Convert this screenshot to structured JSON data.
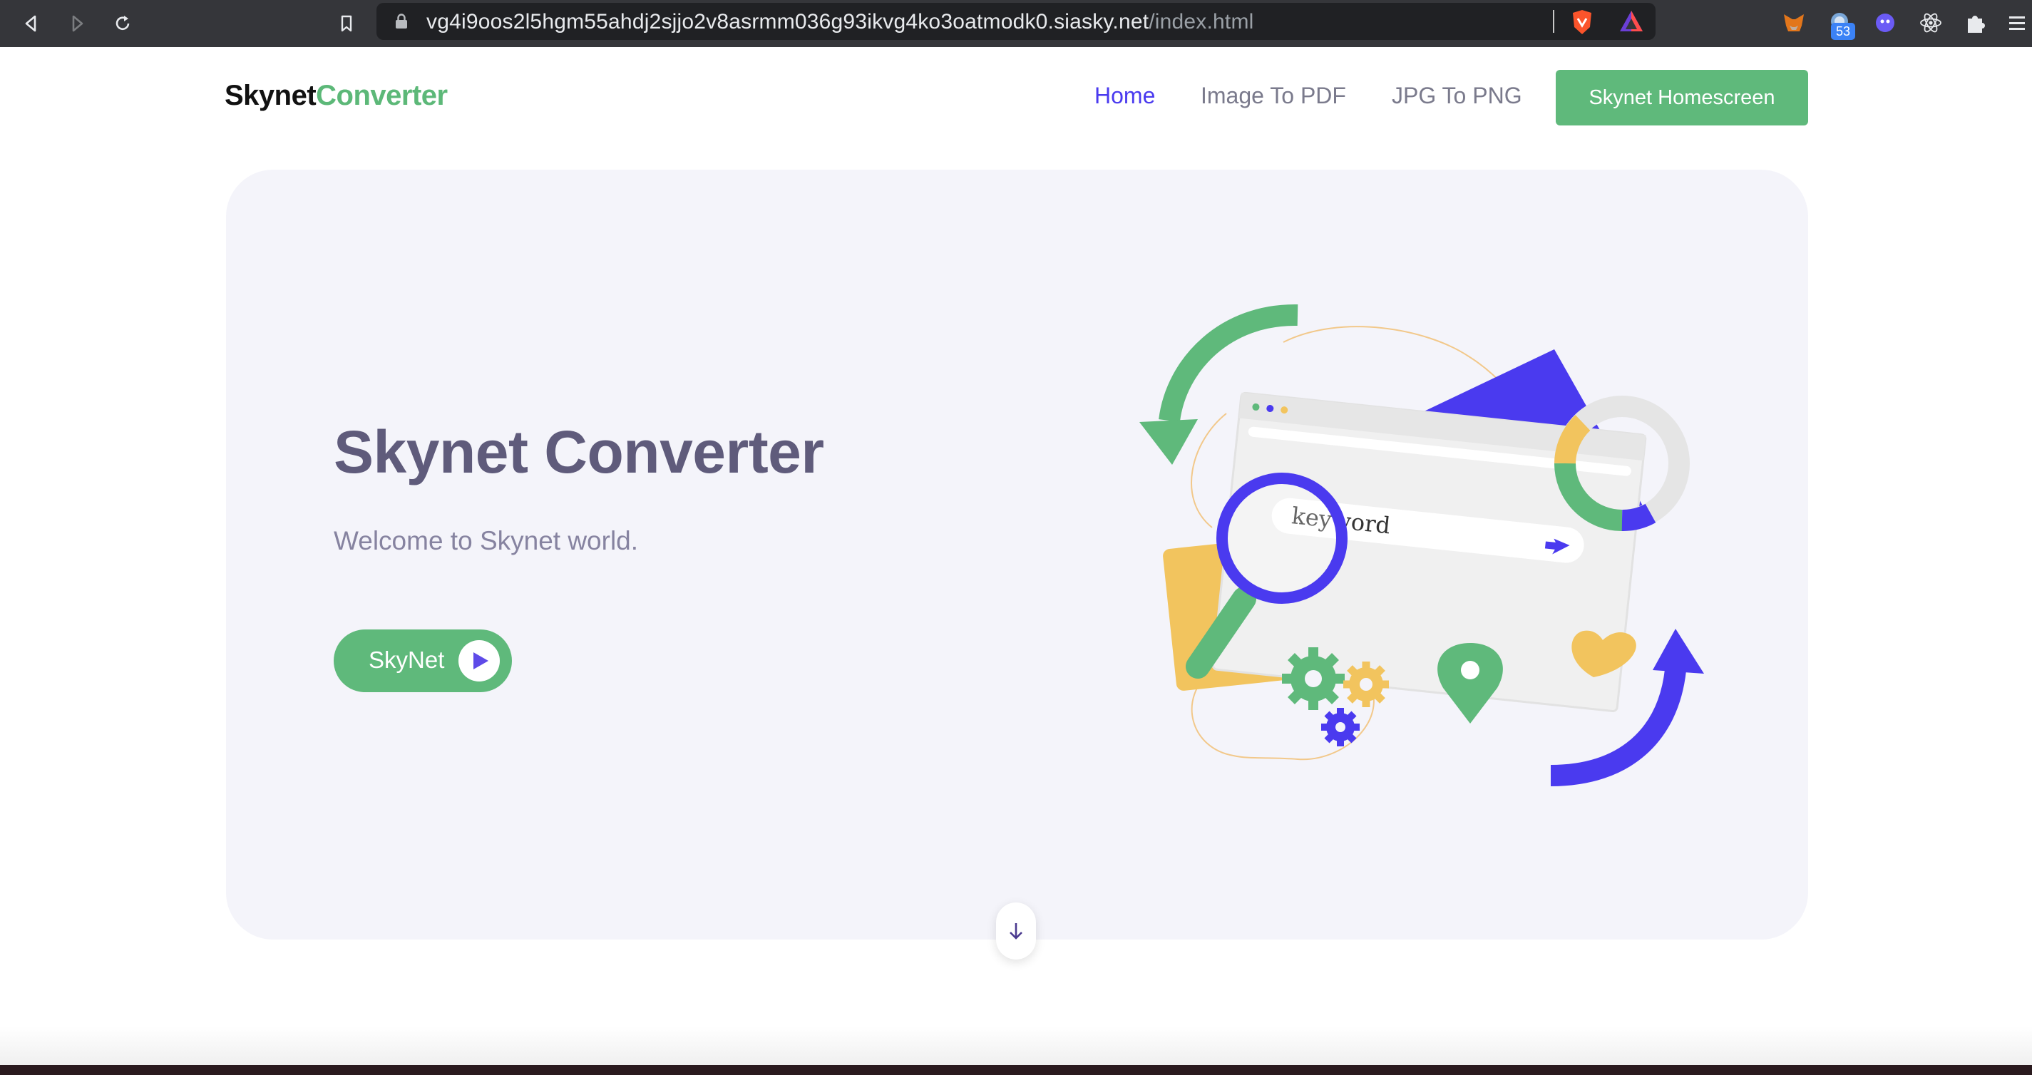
{
  "browser": {
    "url_host": "vg4i9oos2l5hgm55ahdj2sjjo2v8asrmm036g93ikvg4ko3oatmodk0.siasky.net",
    "url_path": "/index.html",
    "extension_badge": "53",
    "icons": [
      "back-icon",
      "forward-icon",
      "reload-icon",
      "bookmark-icon",
      "lock-icon",
      "brave-shield-icon",
      "brave-rewards-icon",
      "metamask-icon",
      "extension-globe-icon",
      "extension-ghost-icon",
      "react-devtools-icon",
      "puzzle-icon",
      "menu-icon"
    ]
  },
  "header": {
    "logo_part1": "Skynet",
    "logo_part2": "Converter",
    "nav": [
      {
        "label": "Home",
        "active": true
      },
      {
        "label": "Image To PDF",
        "active": false
      },
      {
        "label": "JPG To PNG",
        "active": false
      }
    ],
    "cta_label": "Skynet Homescreen"
  },
  "hero": {
    "title": "Skynet Converter",
    "subtitle": "Welcome to Skynet world.",
    "button_label": "SkyNet",
    "illustration_search_text": "keyword"
  },
  "colors": {
    "brand_green": "#5fb97b",
    "brand_purple": "#4a3aef",
    "hero_bg": "#f4f4fa",
    "accent_yellow": "#f2c45e"
  }
}
